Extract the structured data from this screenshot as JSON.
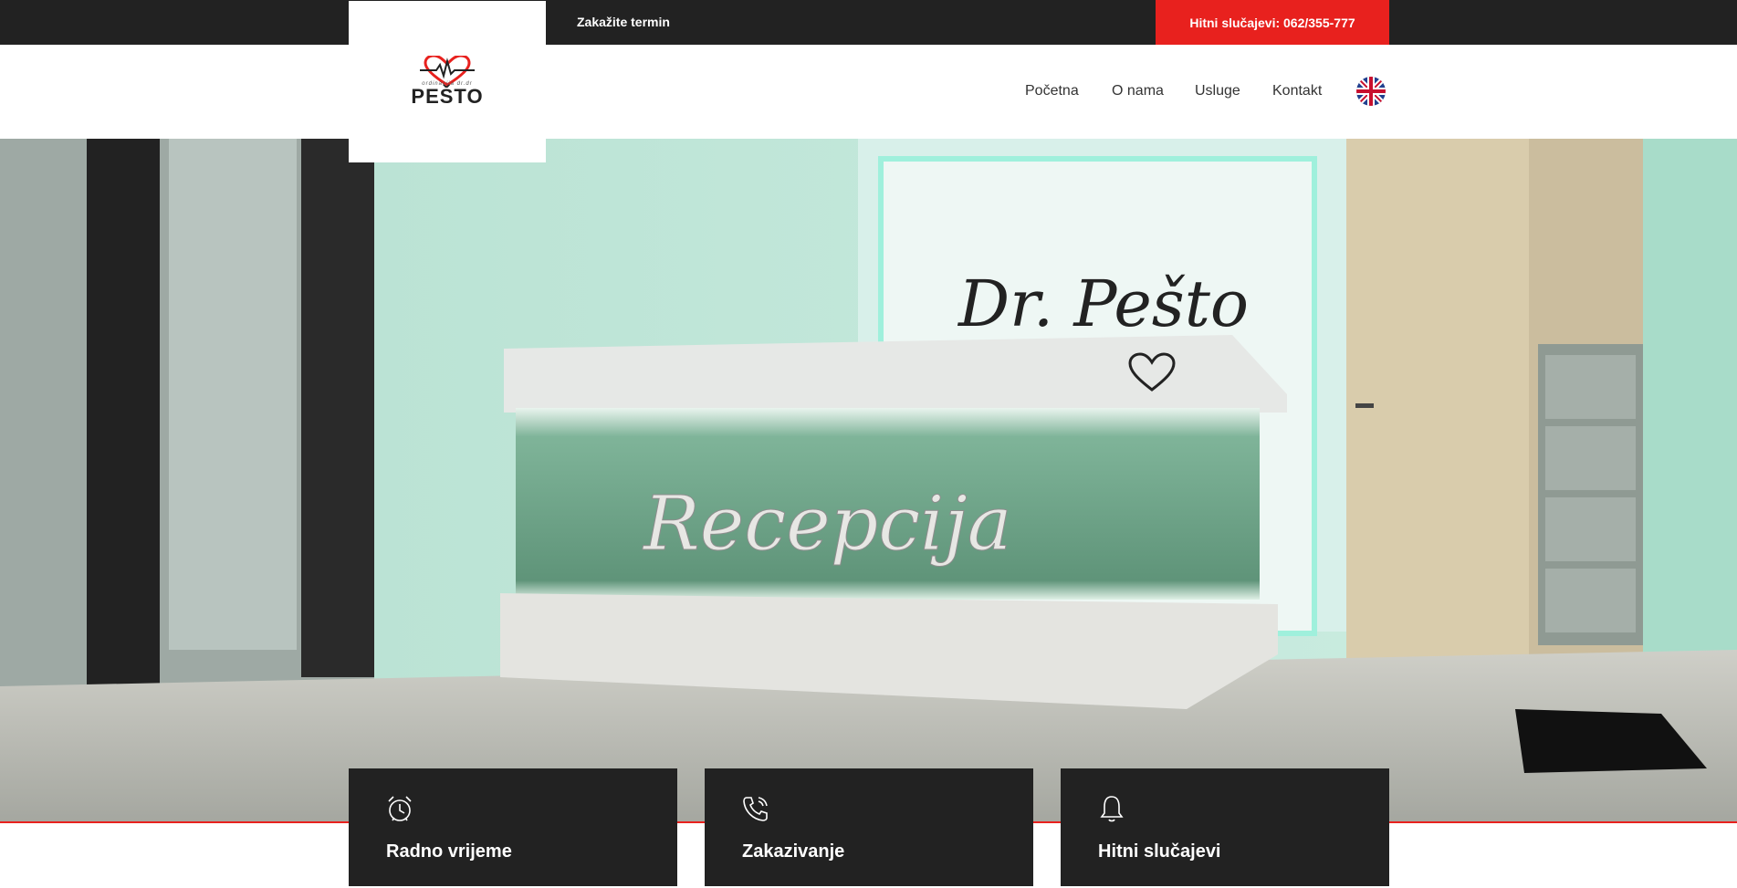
{
  "topbar": {
    "schedule_link": "Zakažite termin",
    "emergency": "Hitni slučajevi: 062/355-777"
  },
  "logo": {
    "name": "PEŠTO",
    "tagline": "ordinacija dr.dr"
  },
  "nav": {
    "items": [
      {
        "label": "Početna"
      },
      {
        "label": "O nama"
      },
      {
        "label": "Usluge"
      },
      {
        "label": "Kontakt"
      }
    ],
    "language_flag": "uk-flag-icon"
  },
  "hero": {
    "wall_sign": "Dr. Pešto",
    "desk_sign": "Recepcija"
  },
  "cards": [
    {
      "title": "Radno vrijeme",
      "icon": "alarm-clock-icon"
    },
    {
      "title": "Zakazivanje",
      "icon": "phone-icon"
    },
    {
      "title": "Hitni slučajevi",
      "icon": "bell-icon"
    }
  ],
  "colors": {
    "dark": "#222222",
    "accent": "#e8211e"
  }
}
